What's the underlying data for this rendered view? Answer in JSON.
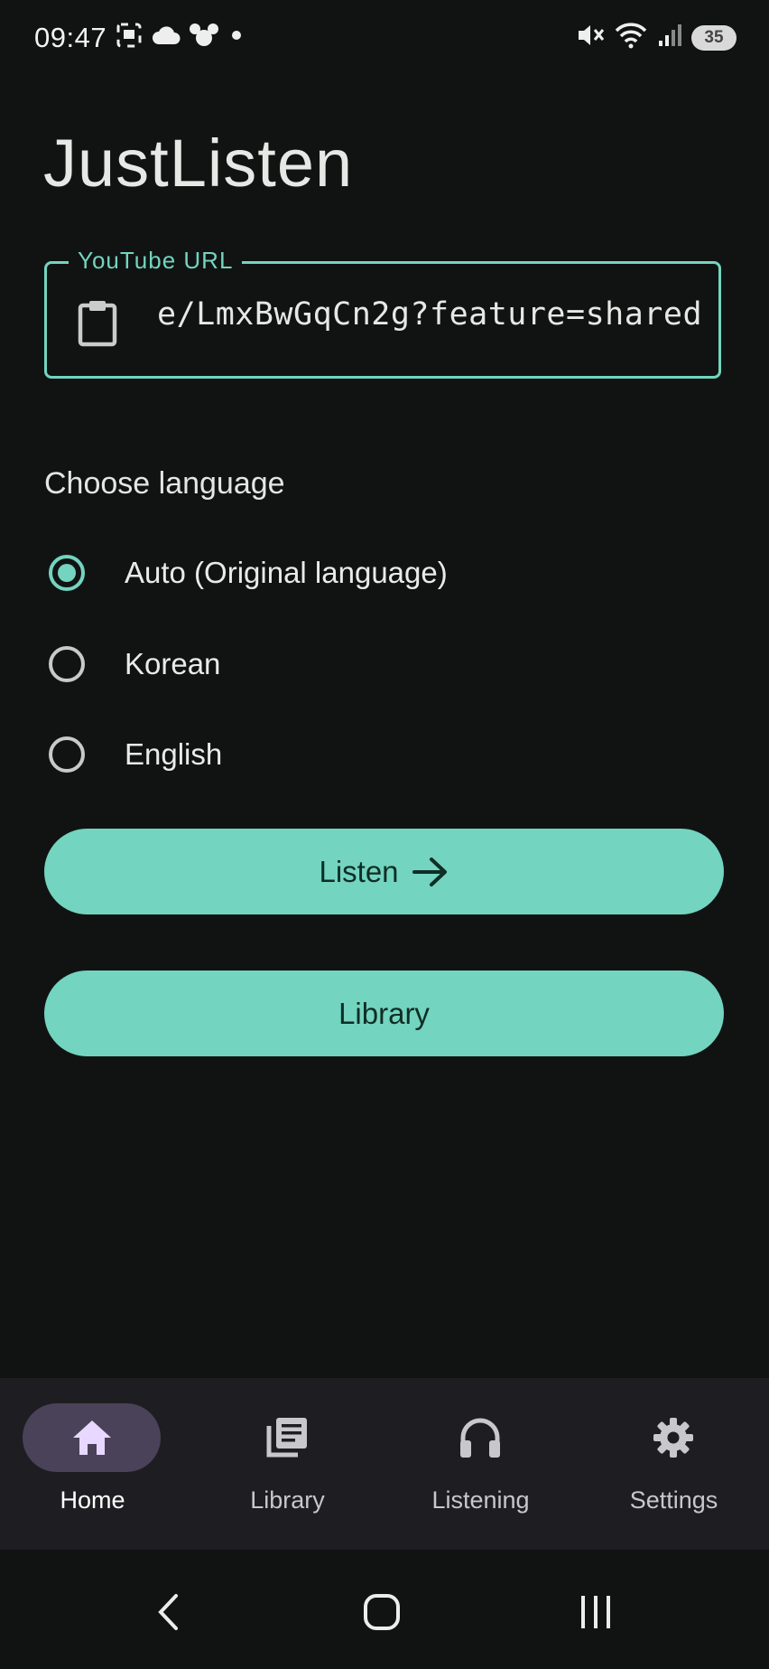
{
  "status_bar": {
    "time": "09:47",
    "left_icons": [
      "screenshot-icon",
      "cloud-icon",
      "mouse-ears-icon",
      "dot-icon"
    ],
    "right_icons": [
      "mute-icon",
      "wifi-icon",
      "signal-icon"
    ],
    "battery": "35"
  },
  "app": {
    "title": "JustListen"
  },
  "url_field": {
    "label": "YouTube URL",
    "value": "e/LmxBwGqCn2g?feature=shared",
    "icon": "clipboard-icon"
  },
  "language": {
    "label": "Choose language",
    "options": [
      {
        "label": "Auto (Original language)",
        "selected": true
      },
      {
        "label": "Korean",
        "selected": false
      },
      {
        "label": "English",
        "selected": false
      }
    ]
  },
  "buttons": {
    "listen": "Listen",
    "library": "Library"
  },
  "bottom_nav": {
    "items": [
      {
        "label": "Home",
        "icon": "home-icon",
        "active": true
      },
      {
        "label": "Library",
        "icon": "library-icon",
        "active": false
      },
      {
        "label": "Listening",
        "icon": "headphones-icon",
        "active": false
      },
      {
        "label": "Settings",
        "icon": "gear-icon",
        "active": false
      }
    ]
  },
  "colors": {
    "accent": "#73d4bf",
    "background": "#111313",
    "nav_background": "#1e1e22",
    "nav_active_pill": "#4a4258",
    "active_icon": "#e8d8ff"
  }
}
